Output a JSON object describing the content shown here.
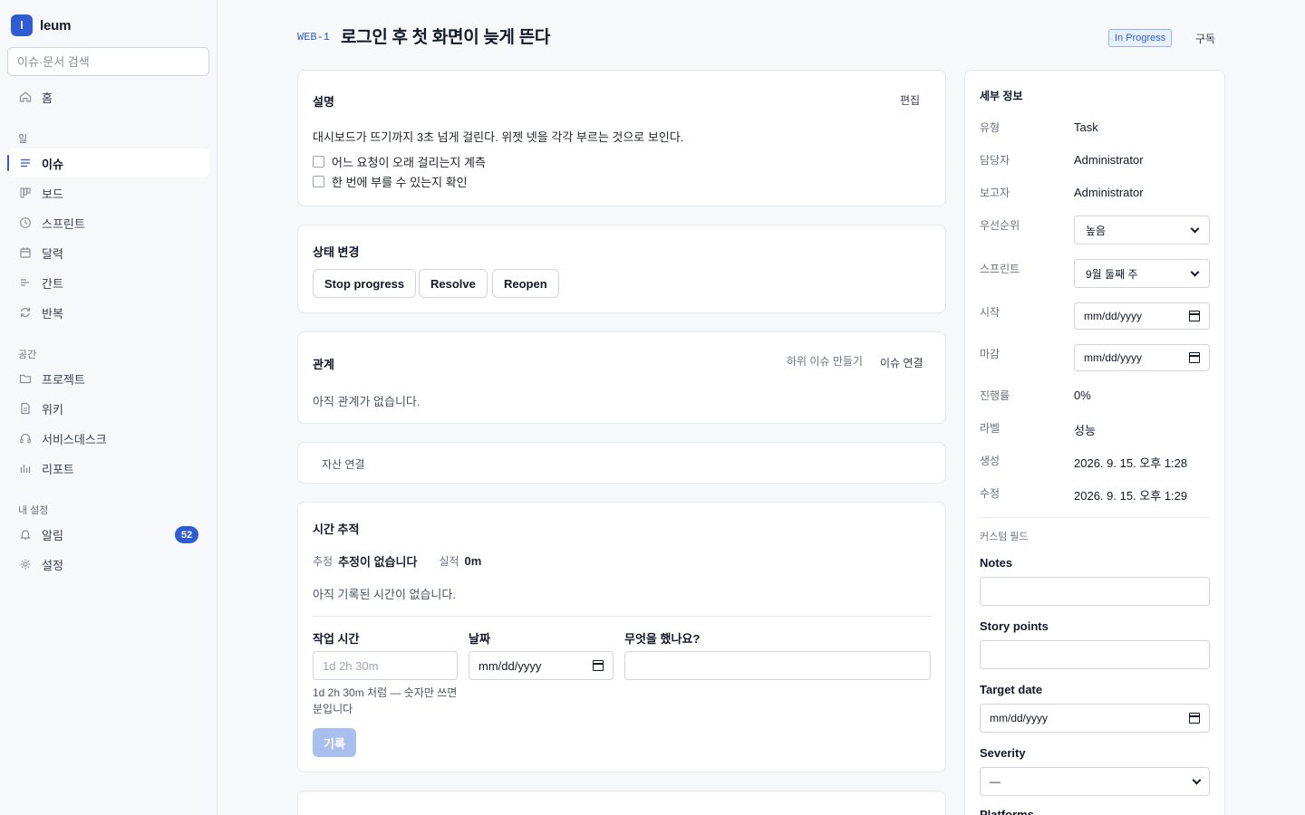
{
  "brand": {
    "logo_letter": "l",
    "name": "leum"
  },
  "search": {
    "placeholder": "이슈·문서 검색"
  },
  "nav": {
    "home": "홈",
    "section_work": "일",
    "issues": "이슈",
    "board": "보드",
    "sprint": "스프린트",
    "calendar": "달력",
    "gantt": "간트",
    "recurring": "반복",
    "section_space": "공간",
    "projects": "프로젝트",
    "wiki": "위키",
    "servicedesk": "서비스데스크",
    "reports": "리포트",
    "section_mysettings": "내 설정",
    "notifications": "알림",
    "notifications_count": "52",
    "settings": "설정"
  },
  "issue": {
    "key": "WEB-1",
    "title": "로그인 후 첫 화면이 늦게 뜬다",
    "status": "In Progress",
    "subscribe_label": "구독"
  },
  "description": {
    "title": "설명",
    "edit_label": "편집",
    "text": "대시보드가 뜨기까지 3초 넘게 걸린다. 위젯 넷을 각각 부르는 것으로 보인다.",
    "checklist": [
      {
        "label": "어느 요청이 오래 걸리는지 계측",
        "checked": false
      },
      {
        "label": "한 번에 부를 수 있는지 확인",
        "checked": false
      }
    ]
  },
  "status_change": {
    "title": "상태 변경",
    "buttons": [
      "Stop progress",
      "Resolve",
      "Reopen"
    ]
  },
  "relations": {
    "title": "관계",
    "create_subissue": "하위 이슈 만들기",
    "link_issue": "이슈 연결",
    "empty": "아직 관계가 없습니다."
  },
  "assets": {
    "label": "자산 연결"
  },
  "time_tracking": {
    "title": "시간 추적",
    "estimate_label": "추정",
    "estimate_value": "추정이 없습니다",
    "actual_label": "실적",
    "actual_value": "0m",
    "empty": "아직 기록된 시간이 없습니다.",
    "work_time_label": "작업 시간",
    "work_time_placeholder": "1d 2h 30m",
    "help_line1": "1d 2h 30m 처럼 — 숫자만 쓰면",
    "help_line2": "분입니다",
    "date_label": "날짜",
    "date_placeholder": "mm/dd/yyyy",
    "what_label": "무엇을 했나요?",
    "submit_label": "기록"
  },
  "details": {
    "title": "세부 정보",
    "type_label": "유형",
    "type_value": "Task",
    "assignee_label": "담당자",
    "assignee_value": "Administrator",
    "reporter_label": "보고자",
    "reporter_value": "Administrator",
    "priority_label": "우선순위",
    "priority_value": "높음",
    "sprint_label": "스프린트",
    "sprint_value": "9월 둘째 주",
    "start_label": "시작",
    "start_value": "mm/dd/yyyy",
    "due_label": "마감",
    "due_value": "mm/dd/yyyy",
    "progress_label": "진행률",
    "progress_value": "0%",
    "labels_label": "라벨",
    "labels_value": "성능",
    "created_label": "생성",
    "created_value": "2026. 9. 15. 오후 1:28",
    "updated_label": "수정",
    "updated_value": "2026. 9. 15. 오후 1:29"
  },
  "custom_fields": {
    "section_label": "커스텀 필드",
    "notes_label": "Notes",
    "story_points_label": "Story points",
    "target_date_label": "Target date",
    "target_date_value": "mm/dd/yyyy",
    "severity_label": "Severity",
    "severity_value": "—",
    "platforms_label": "Platforms"
  }
}
